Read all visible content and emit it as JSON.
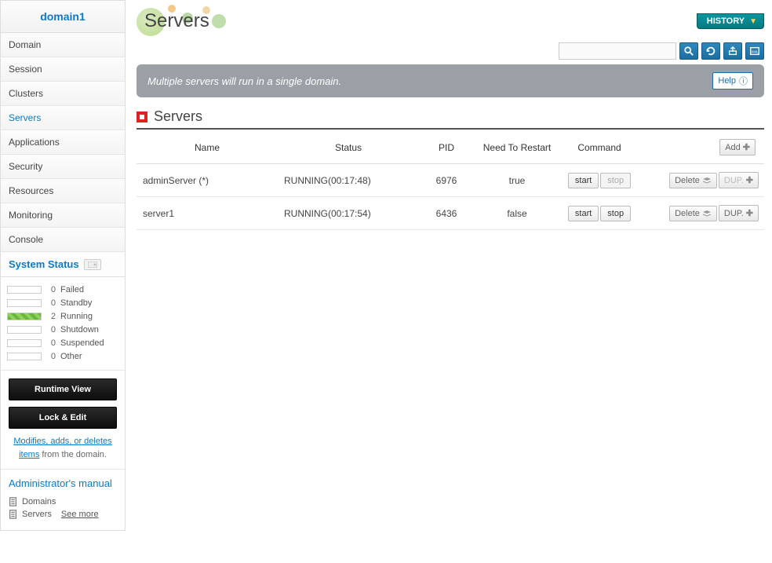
{
  "sidebar": {
    "title": "domain1",
    "nav": [
      "Domain",
      "Session",
      "Clusters",
      "Servers",
      "Applications",
      "Security",
      "Resources",
      "Monitoring",
      "Console"
    ],
    "active_index": 3,
    "system_status_header": "System Status",
    "statuses": [
      {
        "count": "0",
        "label": "Failed",
        "running": false
      },
      {
        "count": "0",
        "label": "Standby",
        "running": false
      },
      {
        "count": "2",
        "label": "Running",
        "running": true
      },
      {
        "count": "0",
        "label": "Shutdown",
        "running": false
      },
      {
        "count": "0",
        "label": "Suspended",
        "running": false
      },
      {
        "count": "0",
        "label": "Other",
        "running": false
      }
    ],
    "buttons": {
      "runtime": "Runtime View",
      "lock": "Lock & Edit"
    },
    "edit_text_link": "Modifies, adds, or deletes items",
    "edit_text_suffix": " from the domain.",
    "admin_manual_title": "Administrator's manual",
    "manual_links": [
      "Domains",
      "Servers"
    ],
    "see_more": "See more"
  },
  "main": {
    "page_title": "Servers",
    "history_label": "HISTORY",
    "search_placeholder": "",
    "banner_text": "Multiple servers will run in a single domain.",
    "help_label": "Help",
    "section_title": "Servers",
    "table": {
      "headers": [
        "Name",
        "Status",
        "PID",
        "Need To Restart",
        "Command"
      ],
      "add_label": "Add",
      "rows": [
        {
          "name": "adminServer (*)",
          "status": "RUNNING(00:17:48)",
          "pid": "6976",
          "restart": "true",
          "stop_disabled": true,
          "dup_disabled": true
        },
        {
          "name": "server1",
          "status": "RUNNING(00:17:54)",
          "pid": "6436",
          "restart": "false",
          "stop_disabled": false,
          "dup_disabled": false
        }
      ],
      "start_label": "start",
      "stop_label": "stop",
      "delete_label": "Delete",
      "dup_label": "DUP."
    }
  }
}
